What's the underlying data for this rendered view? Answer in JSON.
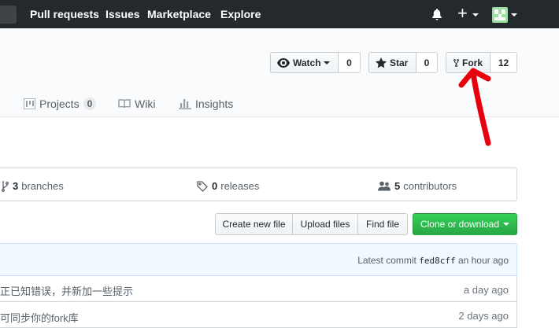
{
  "header": {
    "nav": [
      "Pull requests",
      "Issues",
      "Marketplace",
      "Explore"
    ]
  },
  "repo_actions": {
    "watch": {
      "label": "Watch",
      "count": "0"
    },
    "star": {
      "label": "Star",
      "count": "0"
    },
    "fork": {
      "label": "Fork",
      "count": "12"
    }
  },
  "tabs": {
    "projects": {
      "label": "Projects",
      "count": "0"
    },
    "wiki": {
      "label": "Wiki"
    },
    "insights": {
      "label": "Insights"
    }
  },
  "summary": {
    "branches": {
      "count": "3",
      "label": "branches"
    },
    "releases": {
      "count": "0",
      "label": "releases"
    },
    "contributors": {
      "count": "5",
      "label": "contributors"
    }
  },
  "file_actions": {
    "create": "Create new file",
    "upload": "Upload files",
    "find": "Find file",
    "clone": "Clone or download"
  },
  "commit": {
    "prefix": "Latest commit",
    "sha": "fed8cff",
    "age": "an hour ago"
  },
  "rows": [
    {
      "message": "正已知错误，并新加一些提示",
      "age": "a day ago"
    },
    {
      "message": "可同步你的fork库",
      "age": "2 days ago"
    }
  ],
  "colors": {
    "header_bg": "#24292e",
    "clone_green": "#28a745",
    "annotation_red": "#e8000e"
  },
  "icons": [
    "bell-icon",
    "plus-icon",
    "eye-icon",
    "star-icon",
    "repo-forked-icon",
    "project-icon",
    "book-icon",
    "graph-icon",
    "git-branch-icon",
    "tag-icon",
    "organization-icon"
  ]
}
